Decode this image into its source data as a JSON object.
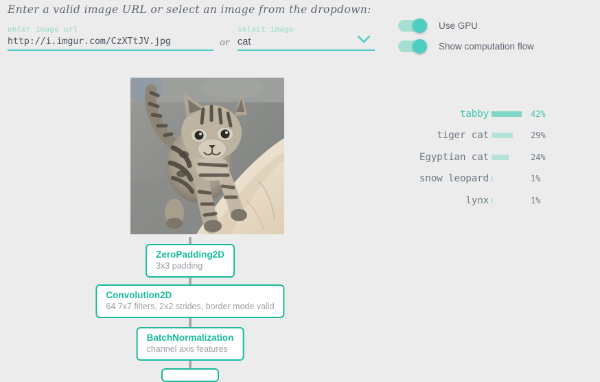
{
  "instruction": "Enter a valid image URL or select an image from the dropdown:",
  "url_field": {
    "label": "enter image url",
    "value": "http://i.imgur.com/CzXTtJV.jpg",
    "placeholder": "enter image url"
  },
  "or_text": "or",
  "select_field": {
    "label": "select image",
    "value": "cat",
    "chevron_icon": "chevron-down-icon"
  },
  "toggles": [
    {
      "label": "Use GPU",
      "on": true
    },
    {
      "label": "Show computation flow",
      "on": true
    }
  ],
  "image": {
    "alt": "tabby kitten walking on concrete",
    "icon": "photo-thumbnail"
  },
  "predictions": [
    {
      "label": "tabby",
      "percent": "42%",
      "value": 42,
      "top": true
    },
    {
      "label": "tiger cat",
      "percent": "29%",
      "value": 29,
      "top": false
    },
    {
      "label": "Egyptian cat",
      "percent": "24%",
      "value": 24,
      "top": false
    },
    {
      "label": "snow leopard",
      "percent": "1%",
      "value": 1,
      "top": false
    },
    {
      "label": "lynx",
      "percent": "1%",
      "value": 1,
      "top": false
    }
  ],
  "layers": [
    {
      "title": "ZeroPadding2D",
      "subtitle": "3x3 padding"
    },
    {
      "title": "Convolution2D",
      "subtitle": "64 7x7 filters, 2x2 strides, border mode valid"
    },
    {
      "title": "BatchNormalization",
      "subtitle": "channel axis features"
    },
    {
      "title": "",
      "subtitle": ""
    }
  ],
  "colors": {
    "accent": "#4ecdc4",
    "layer_border": "#18bc9c",
    "layer_title": "#18bc9c",
    "bar_top": "#7fd6c6",
    "bar": "#b3e3d9",
    "background": "#ececec",
    "text": "#6b7280"
  }
}
